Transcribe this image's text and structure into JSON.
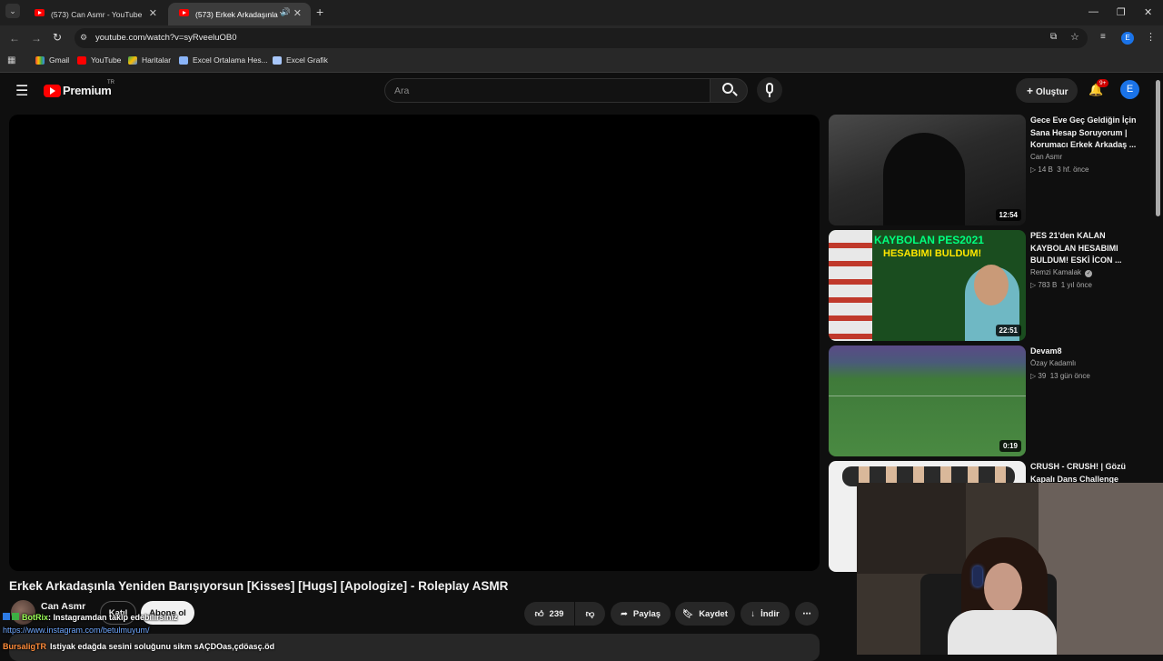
{
  "browser": {
    "tabs": [
      {
        "title": "(573) Can Asmr - YouTube"
      },
      {
        "title": "(573) Erkek Arkadaşınla Yeni"
      }
    ],
    "url": "youtube.com/watch?v=syRveeluOB0",
    "bookmarks": [
      {
        "label": "Gmail"
      },
      {
        "label": "YouTube"
      },
      {
        "label": "Haritalar"
      },
      {
        "label": "Excel Ortalama Hes..."
      },
      {
        "label": "Excel Grafik"
      }
    ],
    "profile_initial": "E"
  },
  "youtube": {
    "logo_text": "Premium",
    "logo_badge": "TR",
    "search_placeholder": "Ara",
    "create_label": "Oluştur",
    "notif_badge": "9+",
    "avatar_initial": "E"
  },
  "video": {
    "title": "Erkek Arkadaşınla Yeniden Barışıyorsun [Kisses] [Hugs] [Apologize] - Roleplay ASMR",
    "channel": "Can Asmr",
    "join_label": "Katıl",
    "subscribe_label": "Abone ol",
    "likes": "239",
    "share_label": "Paylaş",
    "save_label": "Kaydet",
    "download_label": "İndir"
  },
  "recommendations": [
    {
      "title": "Gece Eve Geç Geldiğin İçin Sana Hesap Soruyorum | Korumacı Erkek Arkadaş ...",
      "channel": "Can Asmr",
      "views": "14 B",
      "age": "3 hf. önce",
      "duration": "12:54"
    },
    {
      "title": "PES 21'den KALAN KAYBOLAN HESABIMI BULDUM! ESKİ İCON ...",
      "channel": "Remzi Kamalak",
      "views": "783 B",
      "age": "1 yıl önce",
      "duration": "22:51"
    },
    {
      "title": "Devam8",
      "channel": "Özay Kadamlı",
      "views": "39",
      "age": "13 gün önce",
      "duration": "0:19"
    },
    {
      "title": "CRUSH - CRUSH! | Gözü Kapalı Dans Challenge",
      "channel": "",
      "views": "",
      "age": "",
      "duration": ""
    }
  ],
  "thumb_text": {
    "r2_line1": "KAYBOLAN PES2021",
    "r2_line2": "HESABIMI BULDUM!"
  },
  "stream_overlay": {
    "chat": [
      {
        "user": "BotRix",
        "text": ": Instagramdan takip edebilirsiniz"
      },
      {
        "user": "",
        "text": "https://www.instagram.com/betulmuyum/"
      },
      {
        "user": "BursaligTR",
        "text": "Istiyak edağda sesini soluğunu sikm sAÇDOas,çdöasç.öd"
      }
    ]
  },
  "colors": {
    "yt_red": "#ff0000",
    "link_blue": "#3ea6ff",
    "avatar_blue": "#1a73e8"
  }
}
